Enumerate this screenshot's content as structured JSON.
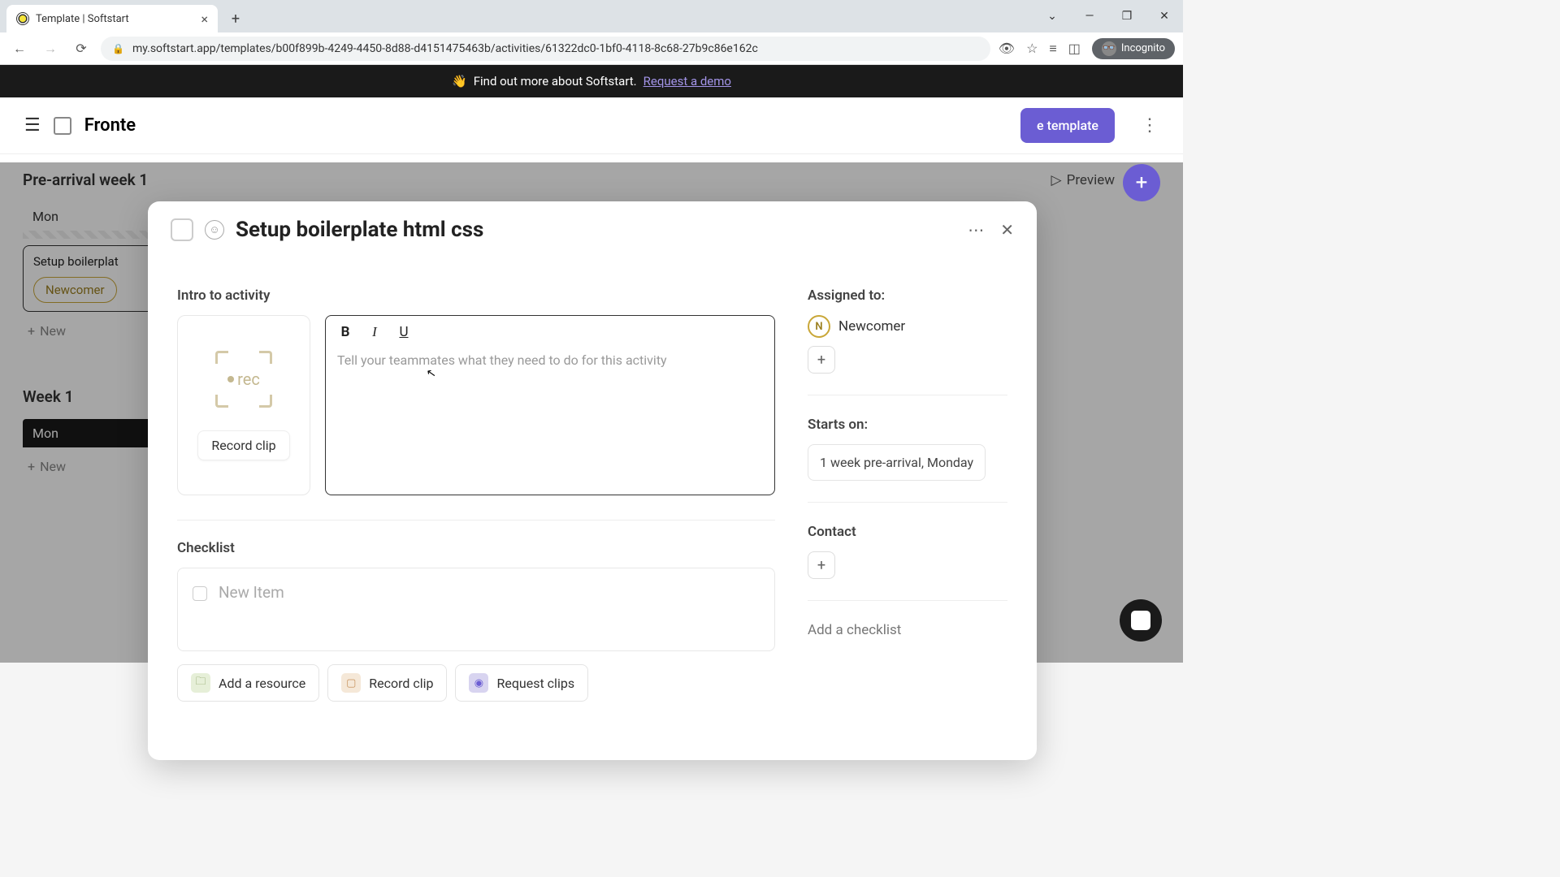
{
  "browser": {
    "tab_title": "Template | Softstart",
    "url": "my.softstart.app/templates/b00f899b-4249-4450-8d88-d4151475463b/activities/61322dc0-1bf0-4118-8c68-27b9c86e162c",
    "incognito": "Incognito"
  },
  "banner": {
    "wave": "👋",
    "text": "Find out more about Softstart.",
    "link": "Request a demo"
  },
  "page": {
    "title_truncated": "Fronte",
    "share_button": "e template",
    "preview": "Preview",
    "sections": {
      "pre": "Pre-arrival week 1",
      "week1": "Week 1"
    },
    "day": "Mon",
    "card_title": "Setup boilerplat",
    "card_tag": "Newcomer",
    "new": "New"
  },
  "modal": {
    "title": "Setup boilerplate html css",
    "intro_label": "Intro to activity",
    "rec_text": "rec",
    "record_button": "Record clip",
    "editor_placeholder": "Tell your teammates what they need to do for this activity",
    "checklist_label": "Checklist",
    "checklist_placeholder": "New Item",
    "attach": {
      "resource": "Add a resource",
      "record": "Record clip",
      "request": "Request clips"
    },
    "right": {
      "assigned_label": "Assigned to:",
      "assignee_initial": "N",
      "assignee_name": "Newcomer",
      "starts_label": "Starts on:",
      "starts_value": "1 week pre-arrival, Monday",
      "contact_label": "Contact",
      "add_checklist": "Add a checklist"
    }
  }
}
